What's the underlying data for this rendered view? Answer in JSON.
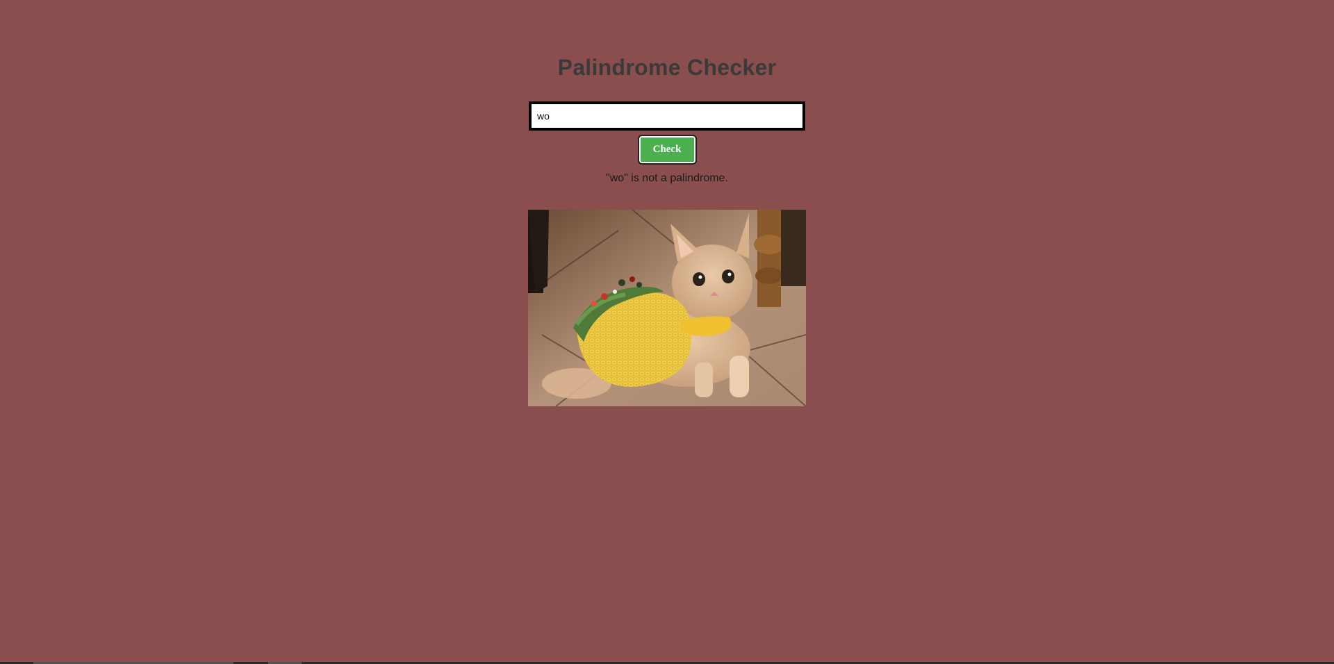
{
  "page": {
    "background": "#8a4e4e"
  },
  "header": {
    "title": "Palindrome Checker"
  },
  "form": {
    "input_value": "wo",
    "check_label": "Check",
    "check_color": "#4caf50"
  },
  "result": {
    "text": "\"wo\" is not a palindrome."
  },
  "image": {
    "subject": "kitten-in-taco-costume"
  }
}
